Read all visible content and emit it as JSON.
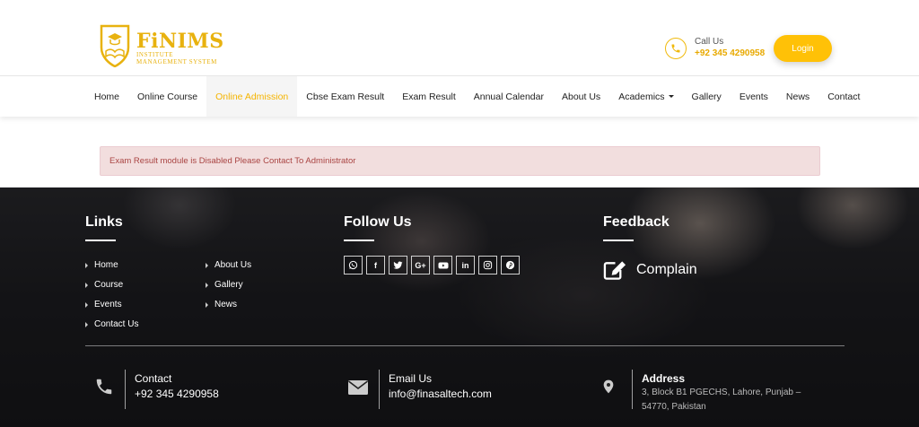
{
  "brand": {
    "name": "FiNIMS",
    "subtitle_line1": "INSTITUTE",
    "subtitle_line2": "MANAGEMENT SYSTEM",
    "accent_color": "#ffc107"
  },
  "header": {
    "call_label": "Call Us",
    "call_number": "+92 345 4290958",
    "login_label": "Login"
  },
  "nav": {
    "items": [
      {
        "label": "Home"
      },
      {
        "label": "Online Course"
      },
      {
        "label": "Online Admission",
        "active": true
      },
      {
        "label": "Cbse Exam Result"
      },
      {
        "label": "Exam Result"
      },
      {
        "label": "Annual Calendar"
      },
      {
        "label": "About Us"
      },
      {
        "label": "Academics",
        "dropdown": true
      },
      {
        "label": "Gallery"
      },
      {
        "label": "Events"
      },
      {
        "label": "News"
      },
      {
        "label": "Contact"
      }
    ]
  },
  "alert": {
    "message": "Exam Result module is Disabled Please Contact To Administrator"
  },
  "footer": {
    "links_heading": "Links",
    "links_col1": [
      "Home",
      "Course",
      "Events",
      "Contact Us"
    ],
    "links_col2": [
      "About Us",
      "Gallery",
      "News"
    ],
    "follow_heading": "Follow Us",
    "social_icons": [
      "whatsapp-icon",
      "facebook-icon",
      "twitter-icon",
      "google-plus-icon",
      "youtube-icon",
      "linkedin-icon",
      "instagram-icon",
      "pinterest-icon"
    ],
    "social_glyphs": {
      "facebook": "f",
      "google_plus": "G+",
      "linkedin": "in"
    },
    "feedback_heading": "Feedback",
    "complain_label": "Complain",
    "contact": {
      "title": "Contact",
      "value": "+92 345 4290958"
    },
    "email": {
      "title": "Email Us",
      "value": "info@finasaltech.com"
    },
    "address": {
      "title": "Address",
      "value": "3, Block B1 PGECHS, Lahore, Punjab – 54770, Pakistan"
    }
  }
}
